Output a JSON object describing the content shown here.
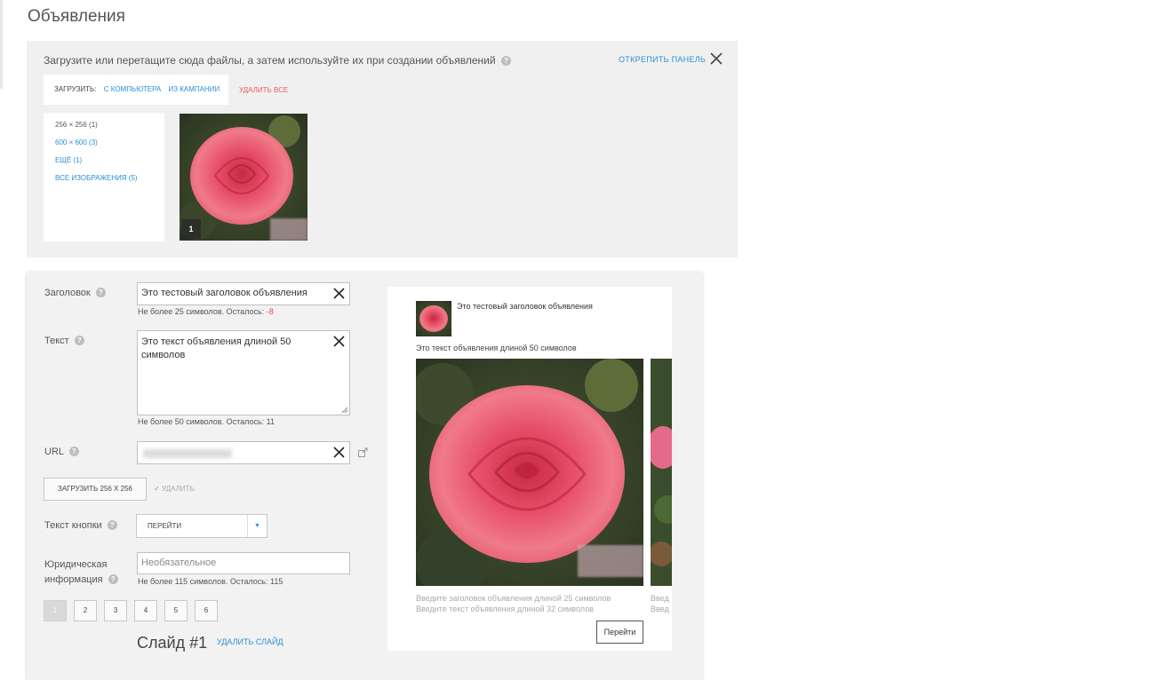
{
  "page": {
    "title": "Объявления"
  },
  "panel": {
    "hint": "Загрузите или перетащите сюда файлы, а затем используйте их при создании объявлений",
    "unpin": "ОТКРЕПИТЬ ПАНЕЛЬ",
    "upload_label": "ЗАГРУЗИТЬ:",
    "from_computer": "С КОМПЬЮТЕРА",
    "from_campaign": "ИЗ КАМПАНИИ",
    "delete_all": "УДАЛИТЬ ВСЕ",
    "sizes": [
      {
        "label": "256 × 256 (1)"
      },
      {
        "label": "600 × 600 (3)"
      },
      {
        "label": "ЕЩЁ (1)"
      },
      {
        "label": "ВСЕ ИЗОБРАЖЕНИЯ (5)"
      }
    ],
    "thumb_number": "1"
  },
  "form": {
    "headline_label": "Заголовок",
    "headline_value": "Это тестовый заголовок объявления",
    "headline_note_prefix": "Не более",
    "headline_note_max": "25",
    "headline_note_mid": "символов. Осталось:",
    "headline_remaining": "-8",
    "text_label": "Текст",
    "text_value": "Это текст объявления длиной 50 символов",
    "text_note": "Не более 50 символов. Осталось: 11",
    "url_label": "URL",
    "upload_button": "ЗАГРУЗИТЬ 256 X 256",
    "delete_image": "УДАЛИТЬ",
    "button_text_label": "Текст кнопки",
    "button_text_value": "ПЕРЕЙТИ",
    "legal_label_1": "Юридическая",
    "legal_label_2": "информация",
    "legal_placeholder": "Необязательное",
    "legal_note": "Не более 115 символов. Осталось: 115",
    "slides": [
      "1",
      "2",
      "3",
      "4",
      "5",
      "6"
    ],
    "slide_title": "Слайд #1",
    "delete_slide": "УДАЛИТЬ СЛАЙД"
  },
  "preview": {
    "title": "Это тестовый заголовок объявления",
    "text": "Это текст объявления длиной 50 символов",
    "ph_title": "Введите заголовок объявления длиной 25 символов",
    "ph_text": "Введите текст объявления длиной 32 символов",
    "ph_title_cut": "Введ",
    "ph_text_cut": "Введ",
    "button": "Перейти"
  },
  "colors": {
    "link": "#2a8fd6",
    "danger": "#e84a4a",
    "panel_bg": "#f0f0f0"
  }
}
